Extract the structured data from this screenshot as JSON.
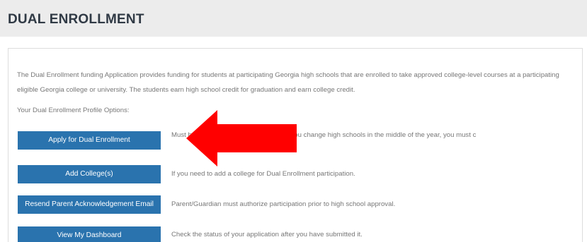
{
  "header": {
    "title": "DUAL ENROLLMENT"
  },
  "intro": {
    "text": "The Dual Enrollment funding Application provides funding for students at participating Georgia high schools that are enrolled to take approved college-level courses at a participating eligible Georgia college or university. The students earn high school credit for graduation and earn college credit."
  },
  "options": {
    "heading": "Your Dual Enrollment Profile Options:",
    "items": [
      {
        "button_label": "Apply for Dual Enrollment",
        "description": "Must be                                                      ose to participate. Note: only if you change high schools in the middle of the year, you must c"
      },
      {
        "button_label": "Add College(s)",
        "description": "If you need to add a college for Dual Enrollment participation."
      },
      {
        "button_label": "Resend Parent Acknowledgement Email",
        "description": "Parent/Guardian must authorize participation prior to high school approval."
      },
      {
        "button_label": "View My Dashboard",
        "description": "Check the status of your application after you have submitted it."
      }
    ]
  },
  "colors": {
    "button_bg": "#2a73ae",
    "arrow": "#ff0000",
    "title": "#303a45"
  },
  "annotation": {
    "icon": "red-arrow-left-icon"
  }
}
